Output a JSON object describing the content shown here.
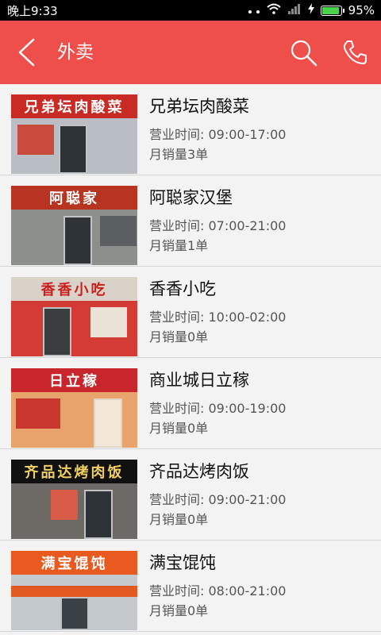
{
  "status_bar": {
    "time": "晚上9:33",
    "battery": "95%",
    "battery_level": 0.95
  },
  "header": {
    "title": "外卖"
  },
  "shops": [
    {
      "name": "兄弟坛肉酸菜",
      "sign": "兄弟坛肉酸菜",
      "hours": "营业时间: 09:00-17:00",
      "sales": "月销量3单",
      "sign_bg": "#c92a24",
      "sign_color": "#ffffff",
      "front_bg": "#b9bec4"
    },
    {
      "name": "阿聪家汉堡",
      "sign": "阿聪家",
      "hours": "营业时间: 07:00-21:00",
      "sales": "月销量1单",
      "sign_bg": "#b73420",
      "sign_color": "#ffffff",
      "front_bg": "#8d8f8c"
    },
    {
      "name": "香香小吃",
      "sign": "香香小吃",
      "hours": "营业时间: 10:00-02:00",
      "sales": "月销量0单",
      "sign_bg": "#d8d2c8",
      "sign_color": "#c8201f",
      "front_bg": "#d43b35"
    },
    {
      "name": "商业城日立稼",
      "sign": "日立稼",
      "hours": "营业时间: 09:00-19:00",
      "sales": "月销量0单",
      "sign_bg": "#c8262c",
      "sign_color": "#ffffff",
      "front_bg": "#e8a36c"
    },
    {
      "name": "齐品达烤肉饭",
      "sign": "齐品达烤肉饭",
      "hours": "营业时间: 09:00-21:00",
      "sales": "月销量0单",
      "sign_bg": "#111111",
      "sign_color": "#f0d060",
      "front_bg": "#6d6a66"
    },
    {
      "name": "满宝馄饨",
      "sign": "满宝馄饨",
      "hours": "营业时间: 08:00-21:00",
      "sales": "月销量0单",
      "sign_bg": "#e85a20",
      "sign_color": "#ffffff",
      "front_bg": "#c4c9cd"
    }
  ]
}
